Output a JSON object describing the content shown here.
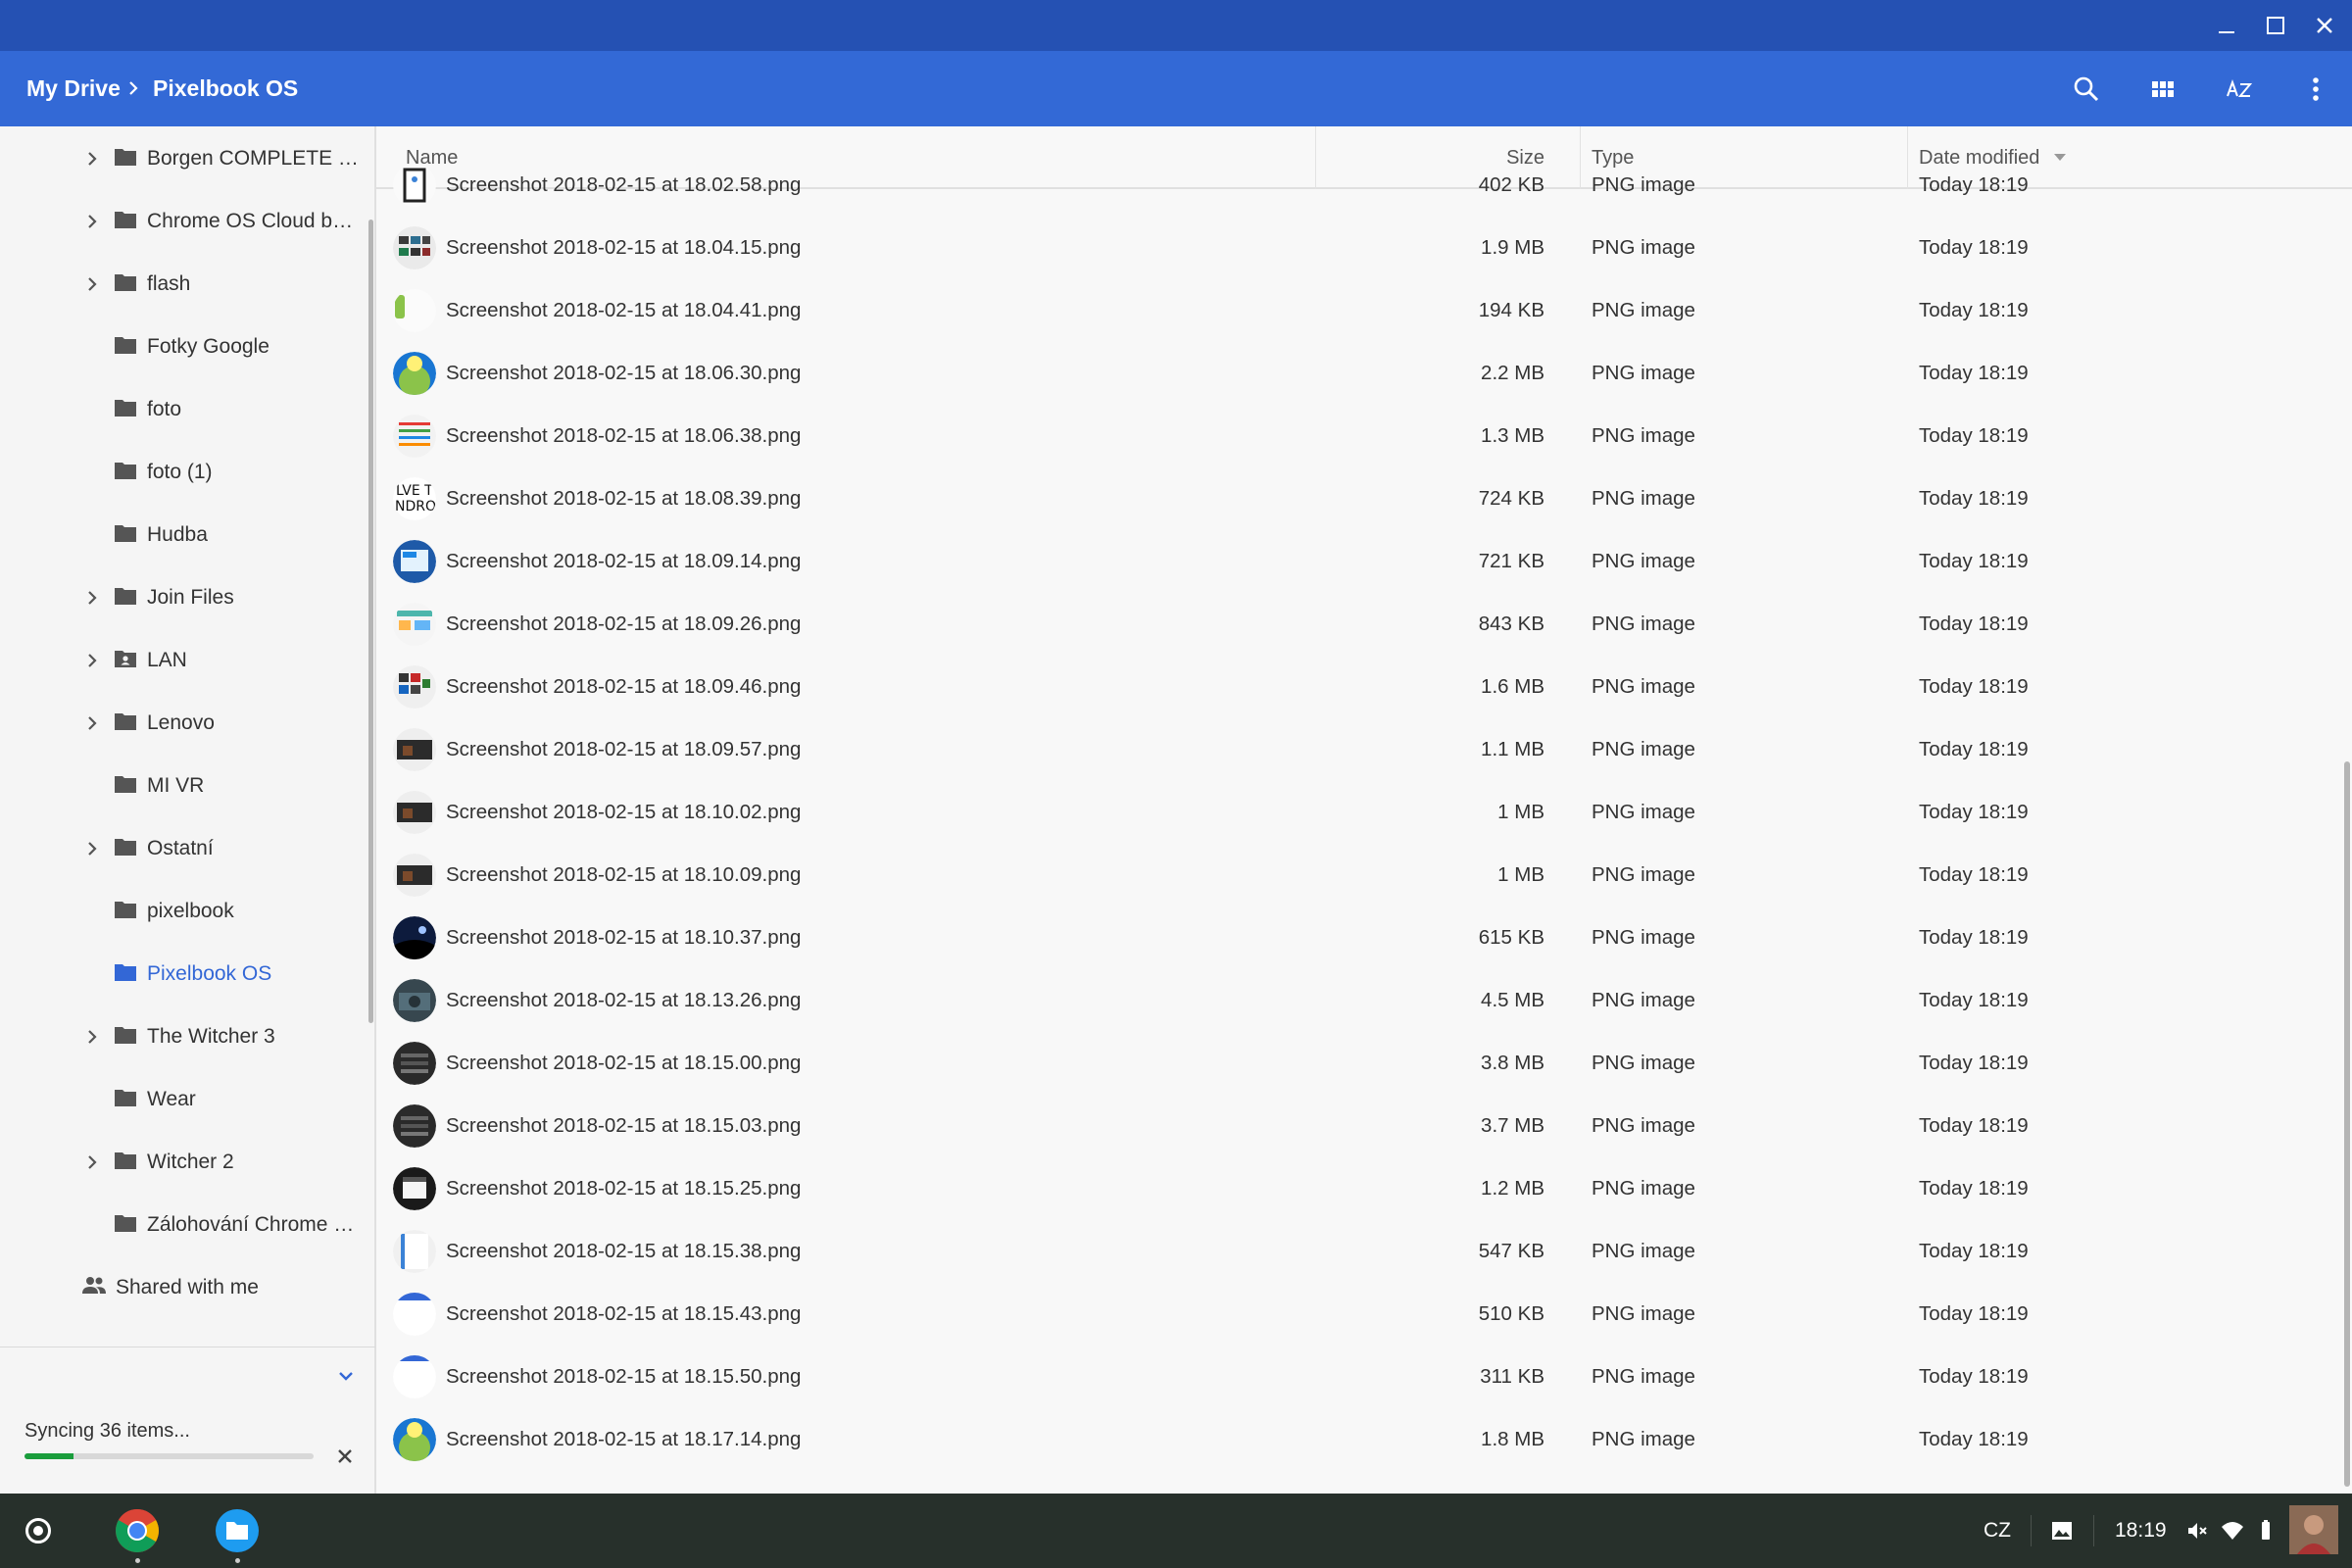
{
  "window": {
    "minimize_icon": "minimize-icon",
    "maximize_icon": "maximize-icon",
    "close_icon": "close-icon"
  },
  "breadcrumb": {
    "root": "My Drive",
    "current": "Pixelbook OS"
  },
  "toolbar": {
    "search_icon": "search-icon",
    "view_icon": "grid-view-icon",
    "sort_icon": "az-sort-icon",
    "more_icon": "more-vert-icon"
  },
  "sidebar": {
    "items": [
      {
        "label": "Borgen COMPLETE S...",
        "expandable": true
      },
      {
        "label": "Chrome OS Cloud bac...",
        "expandable": true
      },
      {
        "label": "flash",
        "expandable": true
      },
      {
        "label": "Fotky Google",
        "expandable": false
      },
      {
        "label": "foto",
        "expandable": false
      },
      {
        "label": "foto (1)",
        "expandable": false
      },
      {
        "label": "Hudba",
        "expandable": false
      },
      {
        "label": "Join Files",
        "expandable": true
      },
      {
        "label": "LAN",
        "expandable": true,
        "shared": true
      },
      {
        "label": "Lenovo",
        "expandable": true
      },
      {
        "label": "MI VR",
        "expandable": false
      },
      {
        "label": "Ostatní",
        "expandable": true
      },
      {
        "label": "pixelbook",
        "expandable": false
      },
      {
        "label": "Pixelbook OS",
        "expandable": false,
        "active": true
      },
      {
        "label": "The Witcher 3",
        "expandable": true
      },
      {
        "label": "Wear",
        "expandable": false
      },
      {
        "label": "Witcher 2",
        "expandable": true
      },
      {
        "label": "Zálohování Chrome O...",
        "expandable": false
      }
    ],
    "shared_with_me": "Shared with me"
  },
  "sync": {
    "text": "Syncing 36 items...",
    "progress": 0.17
  },
  "columns": {
    "name": "Name",
    "size": "Size",
    "type": "Type",
    "date": "Date modified"
  },
  "files": [
    {
      "name": "Screenshot 2018-02-15 at 18.02.58.png",
      "size": "402 KB",
      "type": "PNG image",
      "date": "Today 18:19"
    },
    {
      "name": "Screenshot 2018-02-15 at 18.04.15.png",
      "size": "1.9 MB",
      "type": "PNG image",
      "date": "Today 18:19"
    },
    {
      "name": "Screenshot 2018-02-15 at 18.04.41.png",
      "size": "194 KB",
      "type": "PNG image",
      "date": "Today 18:19"
    },
    {
      "name": "Screenshot 2018-02-15 at 18.06.30.png",
      "size": "2.2 MB",
      "type": "PNG image",
      "date": "Today 18:19"
    },
    {
      "name": "Screenshot 2018-02-15 at 18.06.38.png",
      "size": "1.3 MB",
      "type": "PNG image",
      "date": "Today 18:19"
    },
    {
      "name": "Screenshot 2018-02-15 at 18.08.39.png",
      "size": "724 KB",
      "type": "PNG image",
      "date": "Today 18:19"
    },
    {
      "name": "Screenshot 2018-02-15 at 18.09.14.png",
      "size": "721 KB",
      "type": "PNG image",
      "date": "Today 18:19"
    },
    {
      "name": "Screenshot 2018-02-15 at 18.09.26.png",
      "size": "843 KB",
      "type": "PNG image",
      "date": "Today 18:19"
    },
    {
      "name": "Screenshot 2018-02-15 at 18.09.46.png",
      "size": "1.6 MB",
      "type": "PNG image",
      "date": "Today 18:19"
    },
    {
      "name": "Screenshot 2018-02-15 at 18.09.57.png",
      "size": "1.1 MB",
      "type": "PNG image",
      "date": "Today 18:19"
    },
    {
      "name": "Screenshot 2018-02-15 at 18.10.02.png",
      "size": "1 MB",
      "type": "PNG image",
      "date": "Today 18:19"
    },
    {
      "name": "Screenshot 2018-02-15 at 18.10.09.png",
      "size": "1 MB",
      "type": "PNG image",
      "date": "Today 18:19"
    },
    {
      "name": "Screenshot 2018-02-15 at 18.10.37.png",
      "size": "615 KB",
      "type": "PNG image",
      "date": "Today 18:19"
    },
    {
      "name": "Screenshot 2018-02-15 at 18.13.26.png",
      "size": "4.5 MB",
      "type": "PNG image",
      "date": "Today 18:19"
    },
    {
      "name": "Screenshot 2018-02-15 at 18.15.00.png",
      "size": "3.8 MB",
      "type": "PNG image",
      "date": "Today 18:19"
    },
    {
      "name": "Screenshot 2018-02-15 at 18.15.03.png",
      "size": "3.7 MB",
      "type": "PNG image",
      "date": "Today 18:19"
    },
    {
      "name": "Screenshot 2018-02-15 at 18.15.25.png",
      "size": "1.2 MB",
      "type": "PNG image",
      "date": "Today 18:19"
    },
    {
      "name": "Screenshot 2018-02-15 at 18.15.38.png",
      "size": "547 KB",
      "type": "PNG image",
      "date": "Today 18:19"
    },
    {
      "name": "Screenshot 2018-02-15 at 18.15.43.png",
      "size": "510 KB",
      "type": "PNG image",
      "date": "Today 18:19"
    },
    {
      "name": "Screenshot 2018-02-15 at 18.15.50.png",
      "size": "311 KB",
      "type": "PNG image",
      "date": "Today 18:19"
    },
    {
      "name": "Screenshot 2018-02-15 at 18.17.14.png",
      "size": "1.8 MB",
      "type": "PNG image",
      "date": "Today 18:19"
    }
  ],
  "shelf": {
    "keyboard_layout": "CZ",
    "time": "18:19"
  },
  "colors": {
    "caption": "#2551b3",
    "toolbar": "#3369d6",
    "accent": "#3367d6",
    "shelf": "#27302b",
    "progress": "#1a9d3c"
  }
}
